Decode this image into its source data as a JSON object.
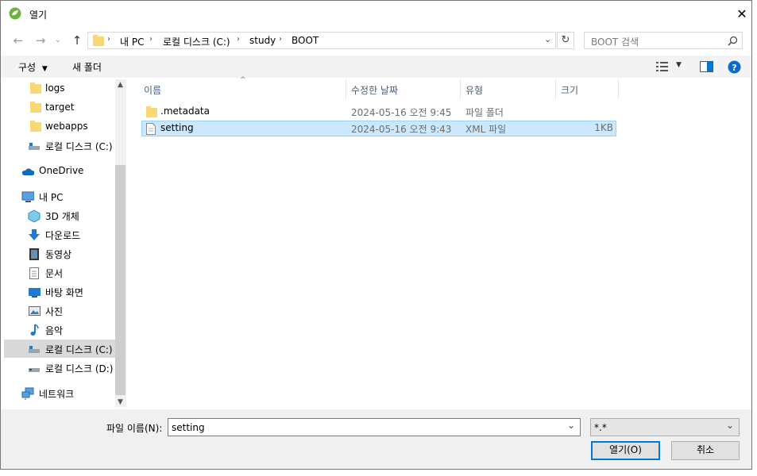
{
  "window": {
    "title": "열기"
  },
  "address": {
    "crumbs": [
      "내 PC",
      "로컬 디스크 (C:)",
      "study",
      "BOOT"
    ]
  },
  "search": {
    "placeholder": "BOOT 검색"
  },
  "toolbar": {
    "organize": "구성",
    "new_folder": "새 폴더"
  },
  "sidebar": {
    "items": [
      {
        "label": "logs",
        "icon": "folder-icon"
      },
      {
        "label": "target",
        "icon": "folder-icon"
      },
      {
        "label": "webapps",
        "icon": "folder-icon"
      },
      {
        "label": "로컬 디스크 (C:)",
        "icon": "drive-icon"
      },
      {
        "label": "OneDrive",
        "icon": "cloud-icon"
      },
      {
        "label": "내 PC",
        "icon": "pc-icon"
      },
      {
        "label": "3D 개체",
        "icon": "cube-icon"
      },
      {
        "label": "다운로드",
        "icon": "download-icon"
      },
      {
        "label": "동영상",
        "icon": "video-icon"
      },
      {
        "label": "문서",
        "icon": "document-icon"
      },
      {
        "label": "바탕 화면",
        "icon": "desktop-icon"
      },
      {
        "label": "사진",
        "icon": "picture-icon"
      },
      {
        "label": "음악",
        "icon": "music-icon"
      },
      {
        "label": "로컬 디스크 (C:)",
        "icon": "drive-icon"
      },
      {
        "label": "로컬 디스크 (D:)",
        "icon": "drive-icon"
      },
      {
        "label": "네트워크",
        "icon": "network-icon"
      }
    ]
  },
  "columns": {
    "name": "이름",
    "modified": "수정한 날짜",
    "type": "유형",
    "size": "크기"
  },
  "files": [
    {
      "name": ".metadata",
      "modified": "2024-05-16 오전 9:45",
      "type": "파일 폴더",
      "size": ""
    },
    {
      "name": "setting",
      "modified": "2024-05-16 오전 9:43",
      "type": "XML 파일",
      "size": "1KB"
    }
  ],
  "bottom": {
    "filename_label": "파일 이름(N):",
    "filename_value": "setting",
    "filter_value": "*.*",
    "open_button": "열기(O)",
    "cancel_button": "취소"
  },
  "colors": {
    "accent": "#0078d7",
    "selection": "#cce8ff",
    "folder": "#f8d775"
  }
}
